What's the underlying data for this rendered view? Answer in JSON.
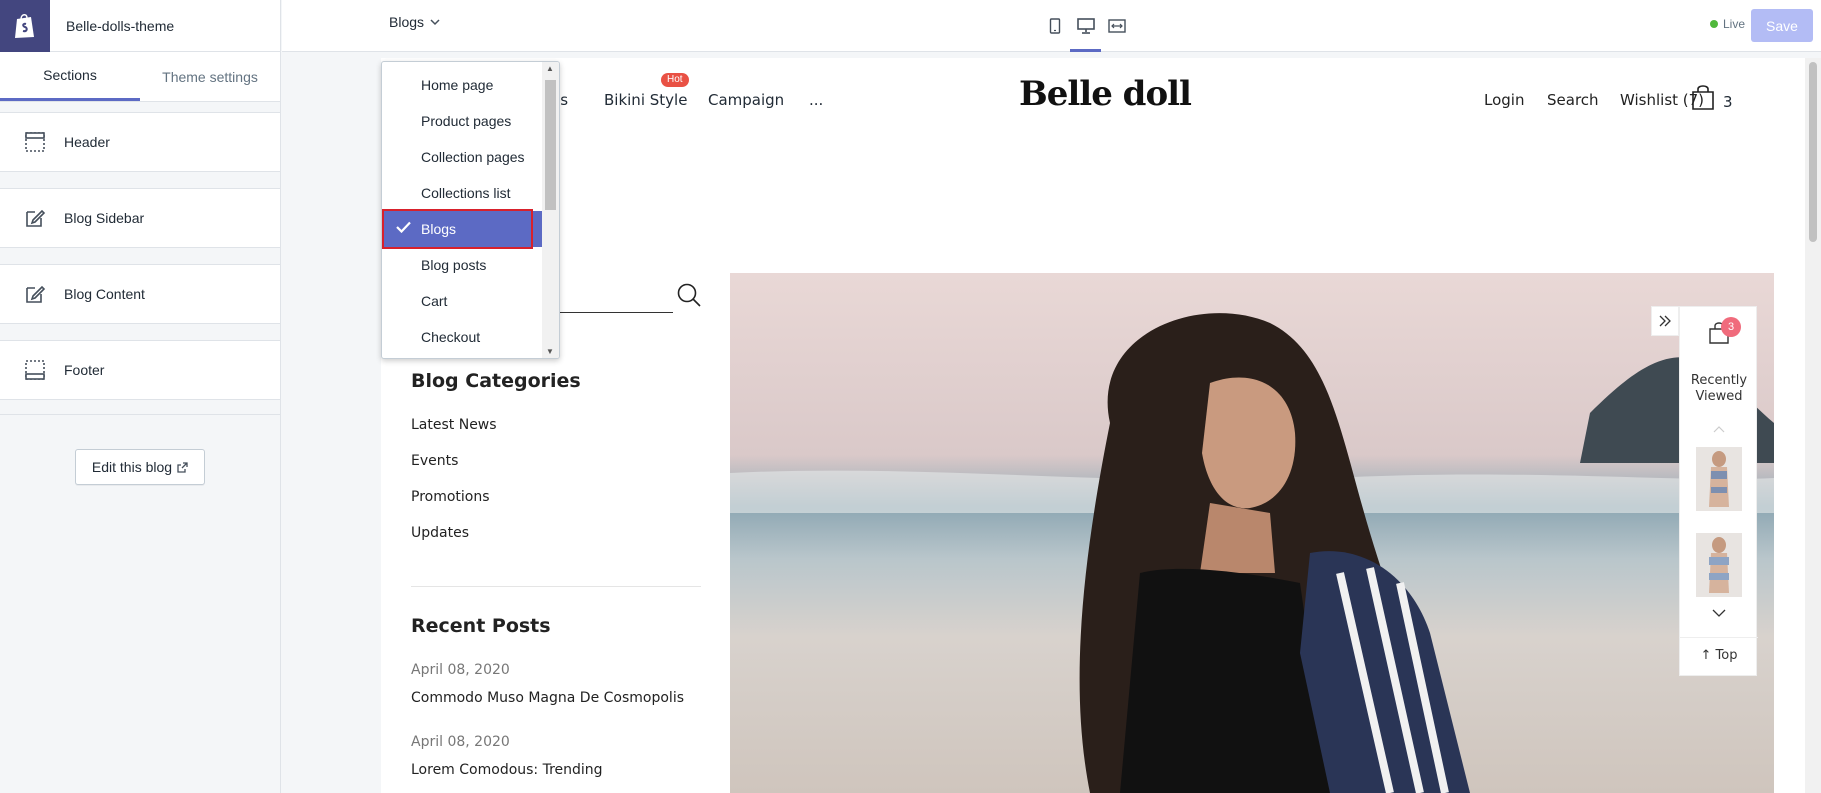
{
  "editor": {
    "theme_name": "Belle-dolls-theme",
    "tabs": [
      "Sections",
      "Theme settings"
    ],
    "sections": [
      {
        "label": "Header",
        "icon": "header-layout-icon"
      },
      {
        "label": "Blog Sidebar",
        "icon": "edit-icon"
      },
      {
        "label": "Blog Content",
        "icon": "edit-icon"
      },
      {
        "label": "Footer",
        "icon": "footer-layout-icon"
      }
    ],
    "edit_blog_label": "Edit this blog"
  },
  "topbar": {
    "template_selected": "Blogs",
    "devices": [
      "mobile",
      "desktop",
      "full-width"
    ],
    "active_device": "desktop",
    "status": "Live",
    "save_label": "Save"
  },
  "template_dropdown": {
    "options": [
      "Home page",
      "Product pages",
      "Collection pages",
      "Collections list",
      "Blogs",
      "Blog posts",
      "Cart",
      "Checkout"
    ],
    "selected": "Blogs"
  },
  "store": {
    "nav_left": [
      "es",
      "Bikini Style",
      "Campaign",
      "..."
    ],
    "hot_badge": "Hot",
    "brand": "Belle doll",
    "nav_right": [
      "Login",
      "Search",
      "Wishlist (7)"
    ],
    "cart_count": "3",
    "blog_categories_title": "Blog Categories",
    "categories": [
      "Latest News",
      "Events",
      "Promotions",
      "Updates"
    ],
    "recent_posts_title": "Recent Posts",
    "recent_posts": [
      {
        "date": "April 08, 2020",
        "title": "Commodo Muso Magna De Cosmopolis"
      },
      {
        "date": "April 08, 2020",
        "title": "Lorem Comodous: Trending"
      }
    ],
    "recently_viewed": {
      "badge": "3",
      "title_line1": "Recently",
      "title_line2": "Viewed",
      "top_label": "Top"
    }
  }
}
